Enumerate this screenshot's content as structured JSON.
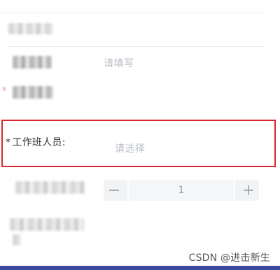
{
  "form": {
    "row2_placeholder": "请填写",
    "highlighted_field": {
      "required_mark": "*",
      "label": "工作班人员:",
      "placeholder": "请选择"
    },
    "stepper": {
      "value": "1",
      "minus_icon": "minus-icon",
      "plus_icon": "plus-icon"
    }
  },
  "watermark": "CSDN @进击新生",
  "colors": {
    "highlight_border": "#d9262f",
    "bottom_bar": "#3b4a9e",
    "placeholder": "#b8bcc6"
  }
}
